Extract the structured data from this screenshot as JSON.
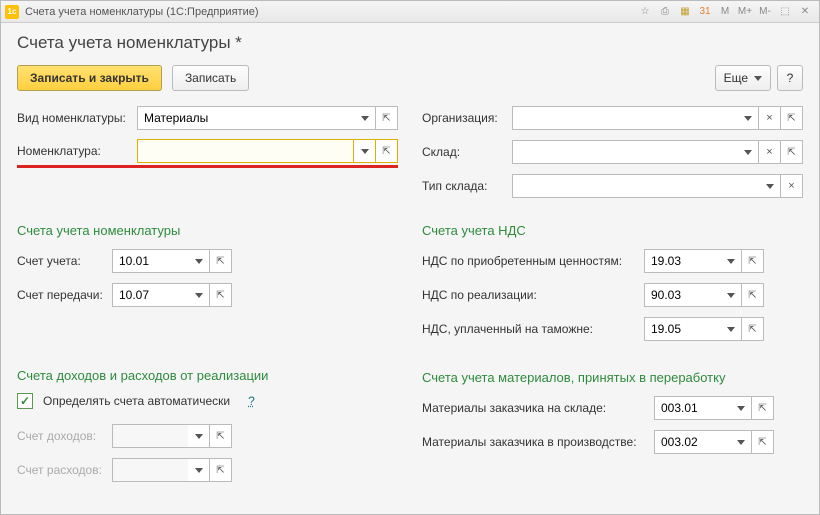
{
  "titlebar": {
    "app_icon": "1c",
    "title": "Счета учета номенклатуры  (1С:Предприятие)",
    "mem_m": "M",
    "mem_mp": "M+",
    "mem_mm": "M-"
  },
  "page_title": "Счета учета номенклатуры *",
  "toolbar": {
    "save_close": "Записать и закрыть",
    "save": "Записать",
    "more": "Еще",
    "help": "?"
  },
  "top_form": {
    "nomenclature_type_label": "Вид номенклатуры:",
    "nomenclature_type_value": "Материалы",
    "nomenclature_label": "Номенклатура:",
    "nomenclature_value": "",
    "organization_label": "Организация:",
    "organization_value": "",
    "warehouse_label": "Склад:",
    "warehouse_value": "",
    "warehouse_type_label": "Тип склада:",
    "warehouse_type_value": ""
  },
  "sections": {
    "accounts_title": "Счета учета номенклатуры",
    "vat_title": "Счета учета НДС",
    "pl_title": "Счета доходов и расходов от реализации",
    "materials_title": "Счета учета материалов, принятых в переработку"
  },
  "accounts": {
    "account_label": "Счет учета:",
    "account_value": "10.01",
    "transfer_label": "Счет передачи:",
    "transfer_value": "10.07"
  },
  "vat": {
    "purchase_label": "НДС по приобретенным ценностям:",
    "purchase_value": "19.03",
    "sales_label": "НДС по реализации:",
    "sales_value": "90.03",
    "customs_label": "НДС, уплаченный на таможне:",
    "customs_value": "19.05"
  },
  "pl": {
    "auto_checkbox_label": "Определять счета автоматически",
    "auto_checked": true,
    "income_label": "Счет доходов:",
    "income_value": "",
    "expense_label": "Счет расходов:",
    "expense_value": ""
  },
  "materials": {
    "stock_label": "Материалы заказчика на складе:",
    "stock_value": "003.01",
    "prod_label": "Материалы заказчика в производстве:",
    "prod_value": "003.02"
  }
}
